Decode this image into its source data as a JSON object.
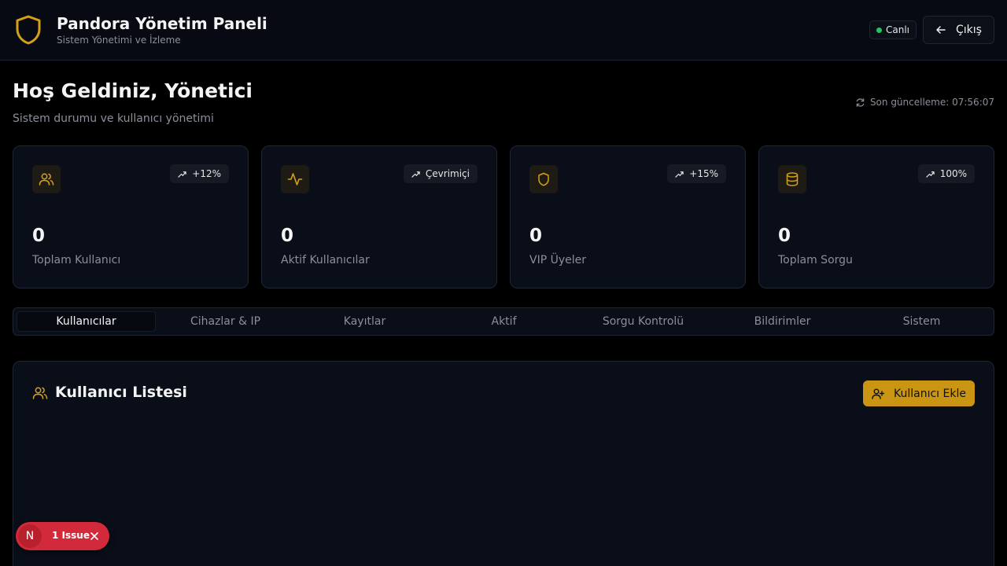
{
  "header": {
    "title": "Pandora Yönetim Paneli",
    "subtitle": "Sistem Yönetimi ve İzleme",
    "icon": "shield-icon",
    "live_label": "Canlı",
    "logout_label": "Çıkış",
    "accent_color": "#d4a017",
    "live_color": "#22c55e"
  },
  "welcome": {
    "title": "Hoş Geldiniz, Yönetici",
    "subtitle": "Sistem durumu ve kullanıcı yönetimi",
    "updated_label": "Son güncelleme: 07:56:07"
  },
  "stats": [
    {
      "icon": "users-icon",
      "trend": "+12%",
      "value": "0",
      "label": "Toplam Kullanıcı"
    },
    {
      "icon": "activity-icon",
      "trend": "Çevrimiçi",
      "value": "0",
      "label": "Aktif Kullanıcılar"
    },
    {
      "icon": "shield-icon",
      "trend": "+15%",
      "value": "0",
      "label": "VIP Üyeler"
    },
    {
      "icon": "database-icon",
      "trend": "100%",
      "value": "0",
      "label": "Toplam Sorgu"
    }
  ],
  "tabs": [
    {
      "label": "Kullanıcılar",
      "active": true
    },
    {
      "label": "Cihazlar & IP",
      "active": false
    },
    {
      "label": "Kayıtlar",
      "active": false
    },
    {
      "label": "Aktif",
      "active": false
    },
    {
      "label": "Sorgu Kontrolü",
      "active": false
    },
    {
      "label": "Bildirimler",
      "active": false
    },
    {
      "label": "Sistem",
      "active": false
    }
  ],
  "user_list": {
    "title": "Kullanıcı Listesi",
    "add_button_label": "Kullanıcı Ekle"
  },
  "issue_toast": {
    "avatar_letter": "N",
    "text": "1 Issue",
    "color": "#d22a3a"
  }
}
